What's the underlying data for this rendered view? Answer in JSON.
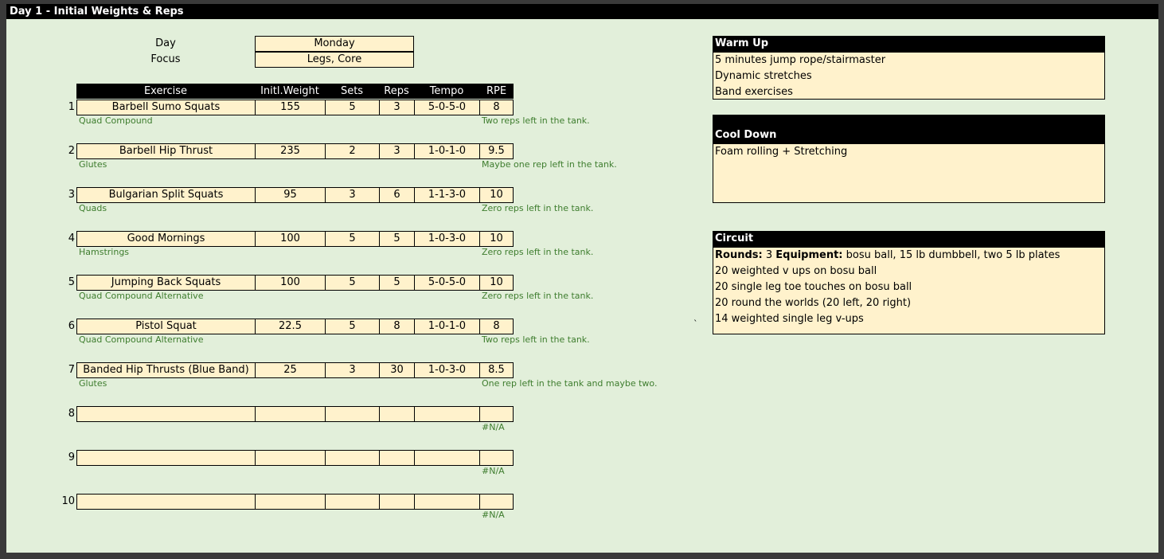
{
  "title": "Day 1 - Initial Weights & Reps",
  "day_label": "Day",
  "day_value": "Monday",
  "focus_label": "Focus",
  "focus_value": "Legs, Core",
  "headers": {
    "exercise": "Exercise",
    "weight": "Initl.Weight",
    "sets": "Sets",
    "reps": "Reps",
    "tempo": "Tempo",
    "rpe": "RPE"
  },
  "rows": [
    {
      "num": "1",
      "exercise": "Barbell Sumo Squats",
      "weight": "155",
      "sets": "5",
      "reps": "3",
      "tempo": "5-0-5-0",
      "rpe": "8",
      "muscle": "Quad Compound",
      "note": "Two reps left in the tank."
    },
    {
      "num": "2",
      "exercise": "Barbell Hip Thrust",
      "weight": "235",
      "sets": "2",
      "reps": "3",
      "tempo": "1-0-1-0",
      "rpe": "9.5",
      "muscle": "Glutes",
      "note": "Maybe one rep left in the tank."
    },
    {
      "num": "3",
      "exercise": "Bulgarian Split Squats",
      "weight": "95",
      "sets": "3",
      "reps": "6",
      "tempo": "1-1-3-0",
      "rpe": "10",
      "muscle": "Quads",
      "note": "Zero reps left in the tank."
    },
    {
      "num": "4",
      "exercise": "Good Mornings",
      "weight": "100",
      "sets": "5",
      "reps": "5",
      "tempo": "1-0-3-0",
      "rpe": "10",
      "muscle": "Hamstrings",
      "note": "Zero reps left in the tank."
    },
    {
      "num": "5",
      "exercise": "Jumping Back Squats",
      "weight": "100",
      "sets": "5",
      "reps": "5",
      "tempo": "5-0-5-0",
      "rpe": "10",
      "muscle": "Quad Compound Alternative",
      "note": "Zero reps left in the tank."
    },
    {
      "num": "6",
      "exercise": "Pistol Squat",
      "weight": "22.5",
      "sets": "5",
      "reps": "8",
      "tempo": "1-0-1-0",
      "rpe": "8",
      "muscle": "Quad Compound Alternative",
      "note": "Two reps left in the tank."
    },
    {
      "num": "7",
      "exercise": "Banded Hip Thrusts (Blue Band)",
      "weight": "25",
      "sets": "3",
      "reps": "30",
      "tempo": "1-0-3-0",
      "rpe": "8.5",
      "muscle": "Glutes",
      "note": "One rep left in the tank and maybe two."
    },
    {
      "num": "8",
      "exercise": "",
      "weight": "",
      "sets": "",
      "reps": "",
      "tempo": "",
      "rpe": "",
      "muscle": "",
      "note": "#N/A"
    },
    {
      "num": "9",
      "exercise": "",
      "weight": "",
      "sets": "",
      "reps": "",
      "tempo": "",
      "rpe": "",
      "muscle": "",
      "note": "#N/A"
    },
    {
      "num": "10",
      "exercise": "",
      "weight": "",
      "sets": "",
      "reps": "",
      "tempo": "",
      "rpe": "",
      "muscle": "",
      "note": "#N/A"
    }
  ],
  "warmup": {
    "title": "Warm Up",
    "lines": [
      "5 minutes jump rope/stairmaster",
      "Dynamic stretches",
      "Band exercises"
    ]
  },
  "cooldown": {
    "title": "Cool Down",
    "lines": [
      "Foam rolling + Stretching"
    ]
  },
  "circuit": {
    "title": "Circuit",
    "rounds_label": "Rounds:",
    "rounds_value": "3",
    "equipment_label": "Equipment:",
    "equipment_value": "bosu ball, 15 lb dumbbell, two 5 lb plates",
    "lines": [
      "20 weighted v ups on bosu ball",
      "20 single leg toe touches on bosu ball",
      "20 round the worlds (20 left, 20 right)",
      "14 weighted single leg v-ups"
    ]
  },
  "stray_mark": "`",
  "colors": {
    "sheet_bg": "#e2efda",
    "cell_bg": "#fff2cc",
    "note_text": "#3e7d2e",
    "header_bg": "#000000"
  }
}
